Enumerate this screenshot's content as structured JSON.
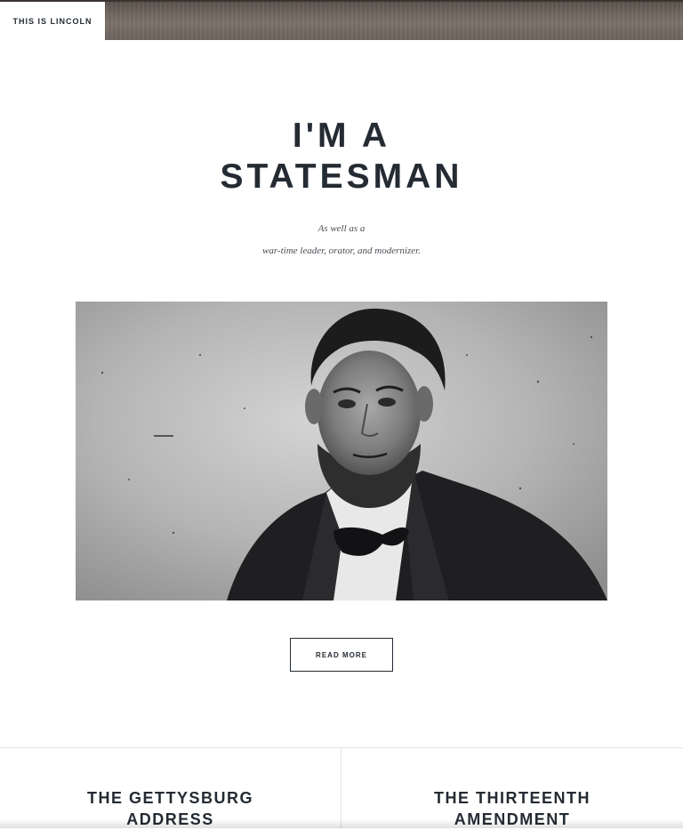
{
  "header": {
    "brand": "THIS IS LINCOLN"
  },
  "hero": {
    "title_line1": "I'M A",
    "title_line2": "STATESMAN",
    "subtitle_line1": "As well as a",
    "subtitle_line2": "war-time leader, orator, and modernizer."
  },
  "portrait": {
    "icon": "abraham-lincoln-portrait"
  },
  "cta": {
    "read_more": "READ MORE"
  },
  "cards": [
    {
      "line1": "THE GETTYSBURG",
      "line2": "ADDRESS"
    },
    {
      "line1": "THE THIRTEENTH",
      "line2": "AMENDMENT"
    }
  ]
}
